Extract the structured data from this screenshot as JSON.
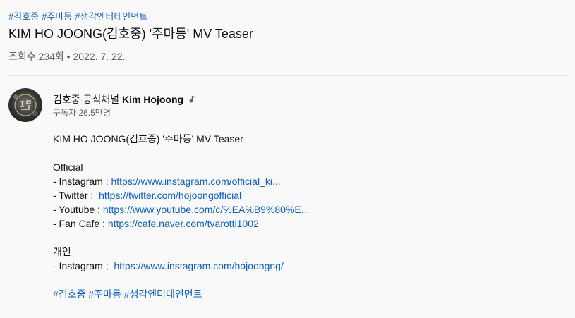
{
  "top_hashtags": [
    "#김호중",
    "#주마등",
    "#생각엔터테인먼트"
  ],
  "video": {
    "title": "KIM HO JOONG(김호중) '주마등' MV Teaser",
    "views": "조회수 234회",
    "separator": "•",
    "date": "2022. 7. 22."
  },
  "channel": {
    "name_ko": "김호중 공식채널 ",
    "name_en": "Kim Hojoong",
    "subscribers": "구독자 26.5만명",
    "badge_icon": "music-note-icon",
    "avatar_colors": {
      "bg": "#2b2b2b",
      "accent": "#cfc8b6"
    }
  },
  "description": {
    "heading": "KIM HO JOONG(김호중) '주마등' MV Teaser",
    "official_label": "Official",
    "official_links": [
      {
        "label": "- Instagram : ",
        "url": "https://www.instagram.com/official_ki..."
      },
      {
        "label": "- Twitter :  ",
        "url": "https://twitter.com/hojoongofficial"
      },
      {
        "label": "- Youtube : ",
        "url": "https://www.youtube.com/c/%EA%B9%80%E..."
      },
      {
        "label": "- Fan Cafe : ",
        "url": "https://cafe.naver.com/tvarotti1002"
      }
    ],
    "personal_label": "개인",
    "personal_links": [
      {
        "label": "- Instagram ;  ",
        "url": "https://www.instagram.com/hojoongng/"
      }
    ],
    "hashtags": [
      "#김호중",
      "#주마등",
      "#생각엔터테인먼트"
    ]
  },
  "colors": {
    "link": "#065fd4",
    "secondary_text": "#606060",
    "background": "#f9f9f9"
  }
}
